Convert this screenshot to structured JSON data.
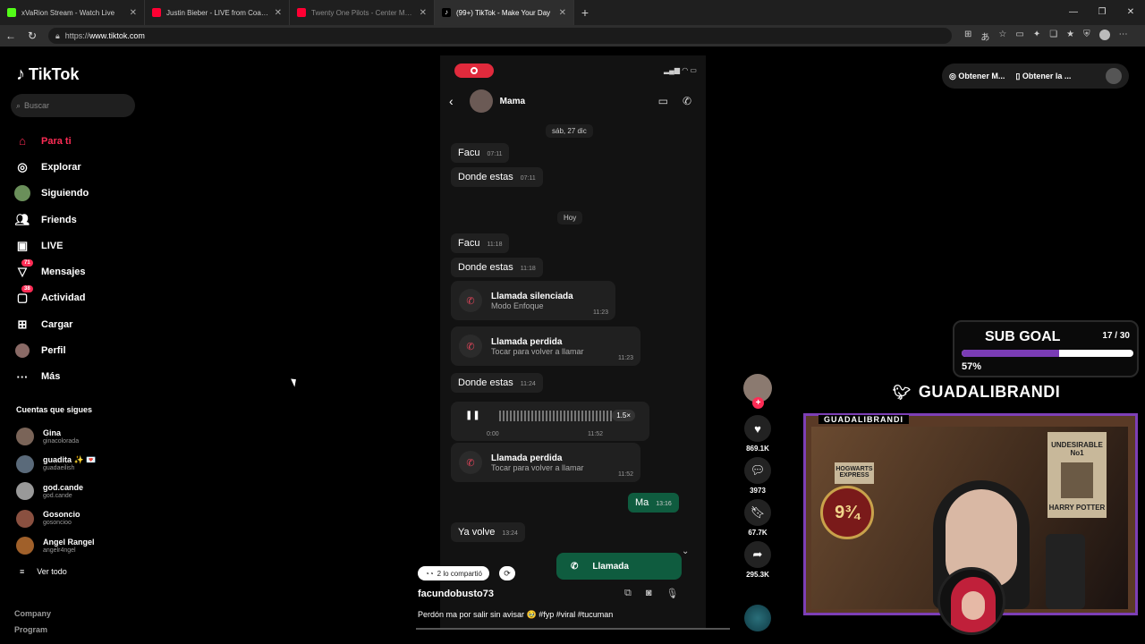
{
  "browser": {
    "tabs": [
      {
        "title": "xVaRion Stream - Watch Live",
        "color": "#53fc18",
        "active": false
      },
      {
        "title": "Justin Bieber - LIVE from Coachella",
        "color": "#ff0033",
        "active": false
      },
      {
        "title": "Twenty One Pilots - Center Mass",
        "color": "#ff0033",
        "active": false
      },
      {
        "title": "(99+) TikTok - Make Your Day",
        "color": "#ffffff",
        "active": true
      }
    ],
    "url_prefix": "https://",
    "url_host": "www.tiktok.com"
  },
  "sidebar": {
    "logo": "TikTok",
    "search_placeholder": "Buscar",
    "nav": [
      {
        "label": "Para ti",
        "icon": "home-icon"
      },
      {
        "label": "Explorar",
        "icon": "compass-icon"
      },
      {
        "label": "Siguiendo",
        "icon": "following-icon"
      },
      {
        "label": "Friends",
        "icon": "friends-icon"
      },
      {
        "label": "LIVE",
        "icon": "live-icon"
      },
      {
        "label": "Mensajes",
        "icon": "messages-icon",
        "badge": "71"
      },
      {
        "label": "Actividad",
        "icon": "activity-icon",
        "badge": "38"
      },
      {
        "label": "Cargar",
        "icon": "upload-icon"
      },
      {
        "label": "Perfil",
        "icon": "profile-icon"
      },
      {
        "label": "Más",
        "icon": "more-icon"
      }
    ],
    "following_title": "Cuentas que sigues",
    "following": [
      {
        "name": "Gina",
        "handle": "ginacolorada"
      },
      {
        "name": "guadita ✨ 💌",
        "handle": "guadaeilish"
      },
      {
        "name": "god.cande",
        "handle": "god.cande"
      },
      {
        "name": "Gosoncio",
        "handle": "gosoncioo"
      },
      {
        "name": "Angel Rangel",
        "handle": "angelr4ngel"
      }
    ],
    "see_all": "Ver todo",
    "footer": [
      "Company",
      "Program"
    ]
  },
  "video": {
    "contact": "Mama",
    "date1": "sáb, 27 dic",
    "date2": "Hoy",
    "m1": {
      "text": "Facu",
      "time": "07:11"
    },
    "m2": {
      "text": "Donde estas",
      "time": "07:11"
    },
    "m3": {
      "text": "Facu",
      "time": "11:18"
    },
    "m4": {
      "text": "Donde estas",
      "time": "11:18"
    },
    "c1": {
      "title": "Llamada silenciada",
      "sub": "Modo Enfoque",
      "time": "11:23"
    },
    "c2": {
      "title": "Llamada perdida",
      "sub": "Tocar para volver a llamar",
      "time": "11:23"
    },
    "m5": {
      "text": "Donde estas",
      "time": "11:24"
    },
    "voice": {
      "start": "0:00",
      "end": "11:52",
      "speed": "1.5×"
    },
    "c3": {
      "title": "Llamada perdida",
      "sub": "Tocar para volver a llamar",
      "time": "11:52"
    },
    "mine": {
      "text": "Ma",
      "time": "13:16"
    },
    "m6": {
      "text": "Ya volve",
      "time": "13:24"
    },
    "callout": "Llamada",
    "shared": "2 lo compartió",
    "author": "facundobusto73",
    "caption": "Perdón ma  por salir sin avisar 🥹 #fyp #viral #tucuman"
  },
  "actions": {
    "likes": "869.1K",
    "comments": "3973",
    "saves": "67.7K",
    "shares": "295.3K"
  },
  "topright": {
    "btn1": "Obtener M...",
    "btn2": "Obtener la ..."
  },
  "stream": {
    "subgoal_label": "SUB GOAL",
    "subgoal_count": "17 / 30",
    "subgoal_pct": "57%",
    "subgoal_fraction": 0.57,
    "twitter": "GUADALIBRANDI",
    "cam_name": "GUADALIBRANDI",
    "poster_hogwarts": "HOGWARTS EXPRESS",
    "poster_platform": "9¾",
    "poster_wanted": "UNDESIRABLE No1",
    "poster_hp": "HARRY POTTER"
  }
}
